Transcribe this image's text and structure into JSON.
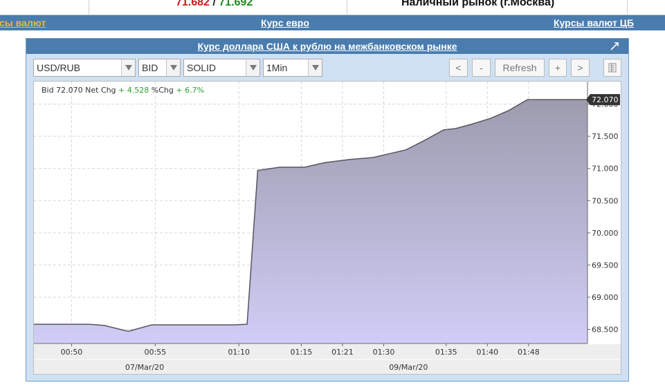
{
  "header": {
    "rate_bid": "71.682",
    "rate_separator": " / ",
    "rate_ask": "71.692",
    "cash_market_label": "Наличный рынок (г.Москва)"
  },
  "nav": {
    "currency_rates": "сы валют",
    "euro_rate": "Курс евро",
    "cb_rates": "Курсы валют ЦБ"
  },
  "widget": {
    "title": "Курс доллара США к рублю на межбанковском рынке",
    "controls": {
      "symbol": "USD/RUB",
      "field": "BID",
      "style": "SOLID",
      "interval": "1Min",
      "prev_label": "<",
      "zoom_out_label": "-",
      "refresh_label": "Refresh",
      "zoom_in_label": "+",
      "next_label": ">"
    }
  },
  "chart_data": {
    "type": "area",
    "info": {
      "bid_label": "Bid",
      "bid_value": "72.070",
      "net_chg_label": "Net Chg",
      "net_chg_value": "+ 4.528",
      "pct_chg_label": "%Chg",
      "pct_chg_value": "+ 6.7%"
    },
    "last_value_label": "72.070",
    "ylim": [
      68.28,
      72.35
    ],
    "y_ticks": [
      68.5,
      69.0,
      69.5,
      70.0,
      70.5,
      71.0,
      71.5,
      72.0
    ],
    "y_tick_labels": [
      "68.500",
      "69.000",
      "69.500",
      "70.000",
      "70.500",
      "71.000",
      "71.500",
      "72.000"
    ],
    "x_ticks": [
      {
        "label": "00:50",
        "pos": 3.2
      },
      {
        "label": "00:55",
        "pos": 10.3
      },
      {
        "label": "01:10",
        "pos": 17.4
      },
      {
        "label": "01:15",
        "pos": 22.7
      },
      {
        "label": "01:21",
        "pos": 26.2
      },
      {
        "label": "01:30",
        "pos": 29.7
      },
      {
        "label": "01:35",
        "pos": 35.0
      },
      {
        "label": "01:40",
        "pos": 38.5
      },
      {
        "label": "01:48",
        "pos": 42.0
      }
    ],
    "x_date_labels": [
      {
        "label": "07/Mar/20",
        "pos": 9.4
      },
      {
        "label": "09/Mar/20",
        "pos": 31.8
      }
    ],
    "x_range": [
      0,
      47
    ],
    "series": [
      {
        "x": [
          0,
          1,
          4.7,
          6.0,
          8.0,
          10.0,
          17.0,
          18.1,
          19.0,
          20.9,
          23.0,
          24.7,
          26.8,
          28.8,
          30.2,
          31.6,
          33.1,
          34.8,
          35.8,
          37.2,
          38.8,
          40.3,
          41.9,
          43.6,
          44.5,
          45.8,
          47.0
        ],
        "y": [
          68.58,
          68.58,
          68.58,
          68.56,
          68.47,
          68.57,
          68.57,
          68.58,
          70.97,
          71.02,
          71.02,
          71.09,
          71.14,
          71.17,
          71.23,
          71.29,
          71.43,
          71.6,
          71.62,
          71.69,
          71.78,
          71.9,
          72.07,
          72.07,
          72.07,
          72.07,
          72.07
        ]
      }
    ],
    "colors": {
      "line": "#57535f",
      "fill_top": "#9d9cae",
      "fill_bottom": "#d0cdf6",
      "bid_value": "#333333",
      "change_value": "#2ea02e"
    },
    "grid": true
  }
}
